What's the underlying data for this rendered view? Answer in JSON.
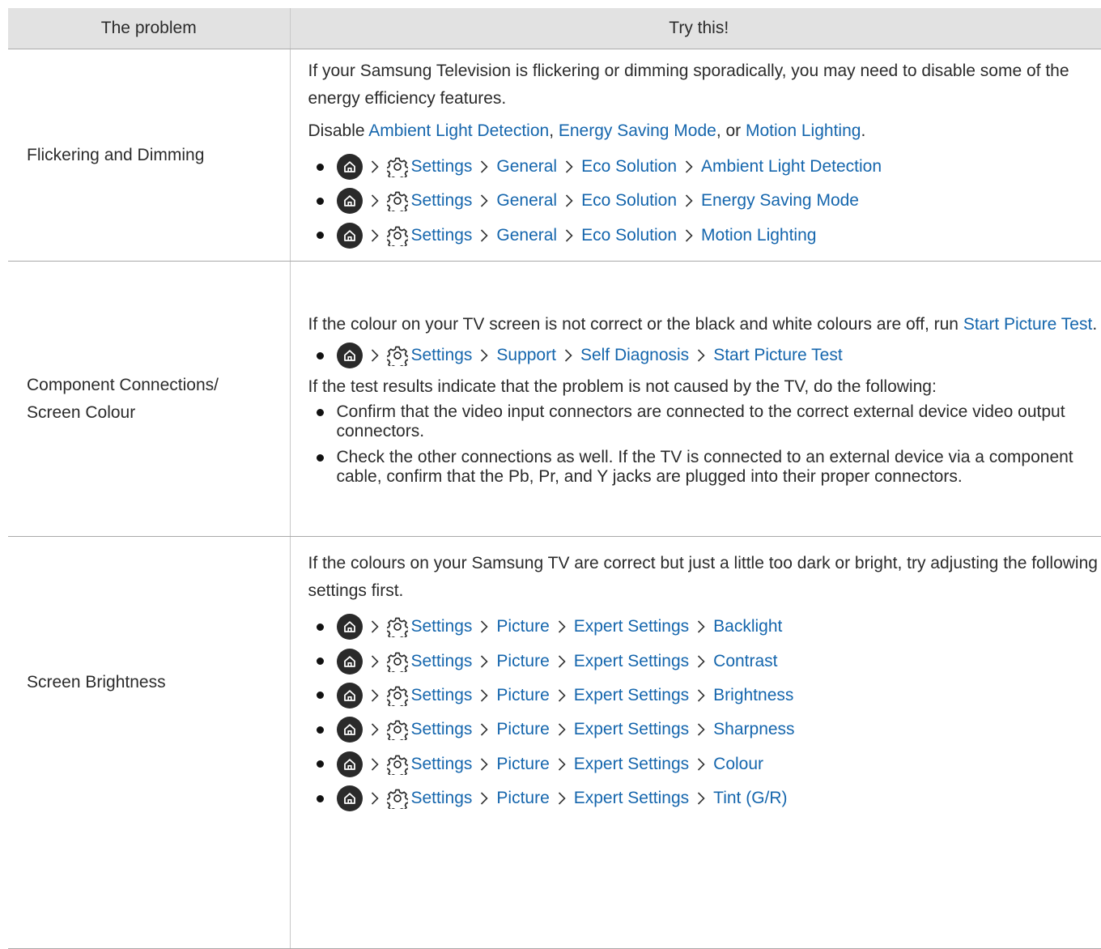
{
  "header": {
    "problem": "The problem",
    "try": "Try this!"
  },
  "rows": [
    {
      "problem": "Flickering and Dimming",
      "intro": "If your Samsung Television is flickering or dimming sporadically, you may need to disable some of the energy efficiency features.",
      "disable": {
        "prefix": "Disable ",
        "item1": "Ambient Light Detection",
        "sep1": ", ",
        "item2": "Energy Saving Mode",
        "sep2": ", or ",
        "item3": "Motion Lighting",
        "end": "."
      },
      "paths": [
        [
          "Settings",
          "General",
          "Eco Solution",
          "Ambient Light Detection"
        ],
        [
          "Settings",
          "General",
          "Eco Solution",
          "Energy Saving Mode"
        ],
        [
          "Settings",
          "General",
          "Eco Solution",
          "Motion Lighting"
        ]
      ]
    },
    {
      "problem_line1": "Component Connections/",
      "problem_line2": "Screen Colour",
      "intro": "If the colour on your TV screen is not correct or the black and white colours are off, run ",
      "intro_link": "Start Picture Test",
      "intro_end": ".",
      "paths": [
        [
          "Settings",
          "Support",
          "Self Diagnosis",
          "Start Picture Test"
        ]
      ],
      "followup": "If the test results indicate that the problem is not caused by the TV, do the following:",
      "bullets": [
        "Confirm that the video input connectors are connected to the correct external device video output connectors.",
        "Check the other connections as well. If the TV is connected to an external device via a component cable, confirm that the Pb, Pr, and Y jacks are plugged into their proper connectors."
      ]
    },
    {
      "problem": "Screen Brightness",
      "intro": "If the colours on your Samsung TV are correct but just a little too dark or bright, try adjusting the following settings first.",
      "paths": [
        [
          "Settings",
          "Picture",
          "Expert Settings",
          "Backlight"
        ],
        [
          "Settings",
          "Picture",
          "Expert Settings",
          "Contrast"
        ],
        [
          "Settings",
          "Picture",
          "Expert Settings",
          "Brightness"
        ],
        [
          "Settings",
          "Picture",
          "Expert Settings",
          "Sharpness"
        ],
        [
          "Settings",
          "Picture",
          "Expert Settings",
          "Colour"
        ],
        [
          "Settings",
          "Picture",
          "Expert Settings",
          "Tint (G/R)"
        ]
      ]
    }
  ],
  "colors": {
    "link": "#1566ad",
    "header_bg": "#e2e2e2",
    "home_icon_bg": "#2a2a2a"
  },
  "icons": {
    "home": "home-icon",
    "gear": "gear-icon",
    "chevron": "chevron-right-icon",
    "bullet": "bullet-dot"
  }
}
